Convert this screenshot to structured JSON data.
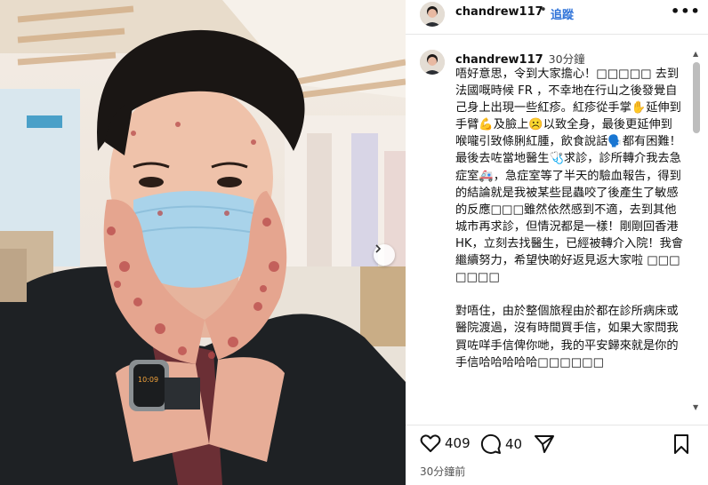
{
  "post": {
    "username": "chandrew117",
    "follow_label": "追蹤",
    "separator": "•",
    "more_label": "•••"
  },
  "caption": {
    "username": "chandrew117",
    "time": "30分鐘",
    "body": "唔好意思，令到大家擔心！□□□□□ 去到法國嘅時候 FR ，不幸地在行山之後發覺自己身上出現一些紅疹。紅疹從手掌✋延伸到手臂💪及臉上☹️以致全身，最後更延伸到喉嚨引致條脷紅腫，飲食說話🗣️都有困難！最後去咗當地醫生🩺求診，診所轉介我去急症室🚑，急症室等了半天的驗血報告，得到的結論就是我被某些昆蟲咬了後產生了敏感的反應□□□雖然依然感到不適，去到其他城市再求診，但情況都是一樣！剛剛回香港 HK，立刻去找醫生，已經被轉介入院！我會繼續努力，希望快啲好返見返大家啦 □□□□□□□\n\n對唔住，由於整個旅程由於都在診所病床或醫院渡過，沒有時間買手信，如果大家問我買咗咩手信俾你哋，我的平安歸來就是你的手信哈哈哈哈哈□□□□□□"
  },
  "stats": {
    "likes": "409",
    "comments": "40",
    "posted": "30分鐘前"
  },
  "icons": {
    "like": "heart-icon",
    "comment": "comment-bubble-icon",
    "share": "paper-plane-icon",
    "save": "bookmark-icon",
    "carousel_next": "chevron-right-icon",
    "scroll_up": "scroll-up-arrow-icon",
    "scroll_down": "scroll-down-arrow-icon"
  },
  "colors": {
    "follow": "#2f73d9",
    "text": "#111111"
  }
}
